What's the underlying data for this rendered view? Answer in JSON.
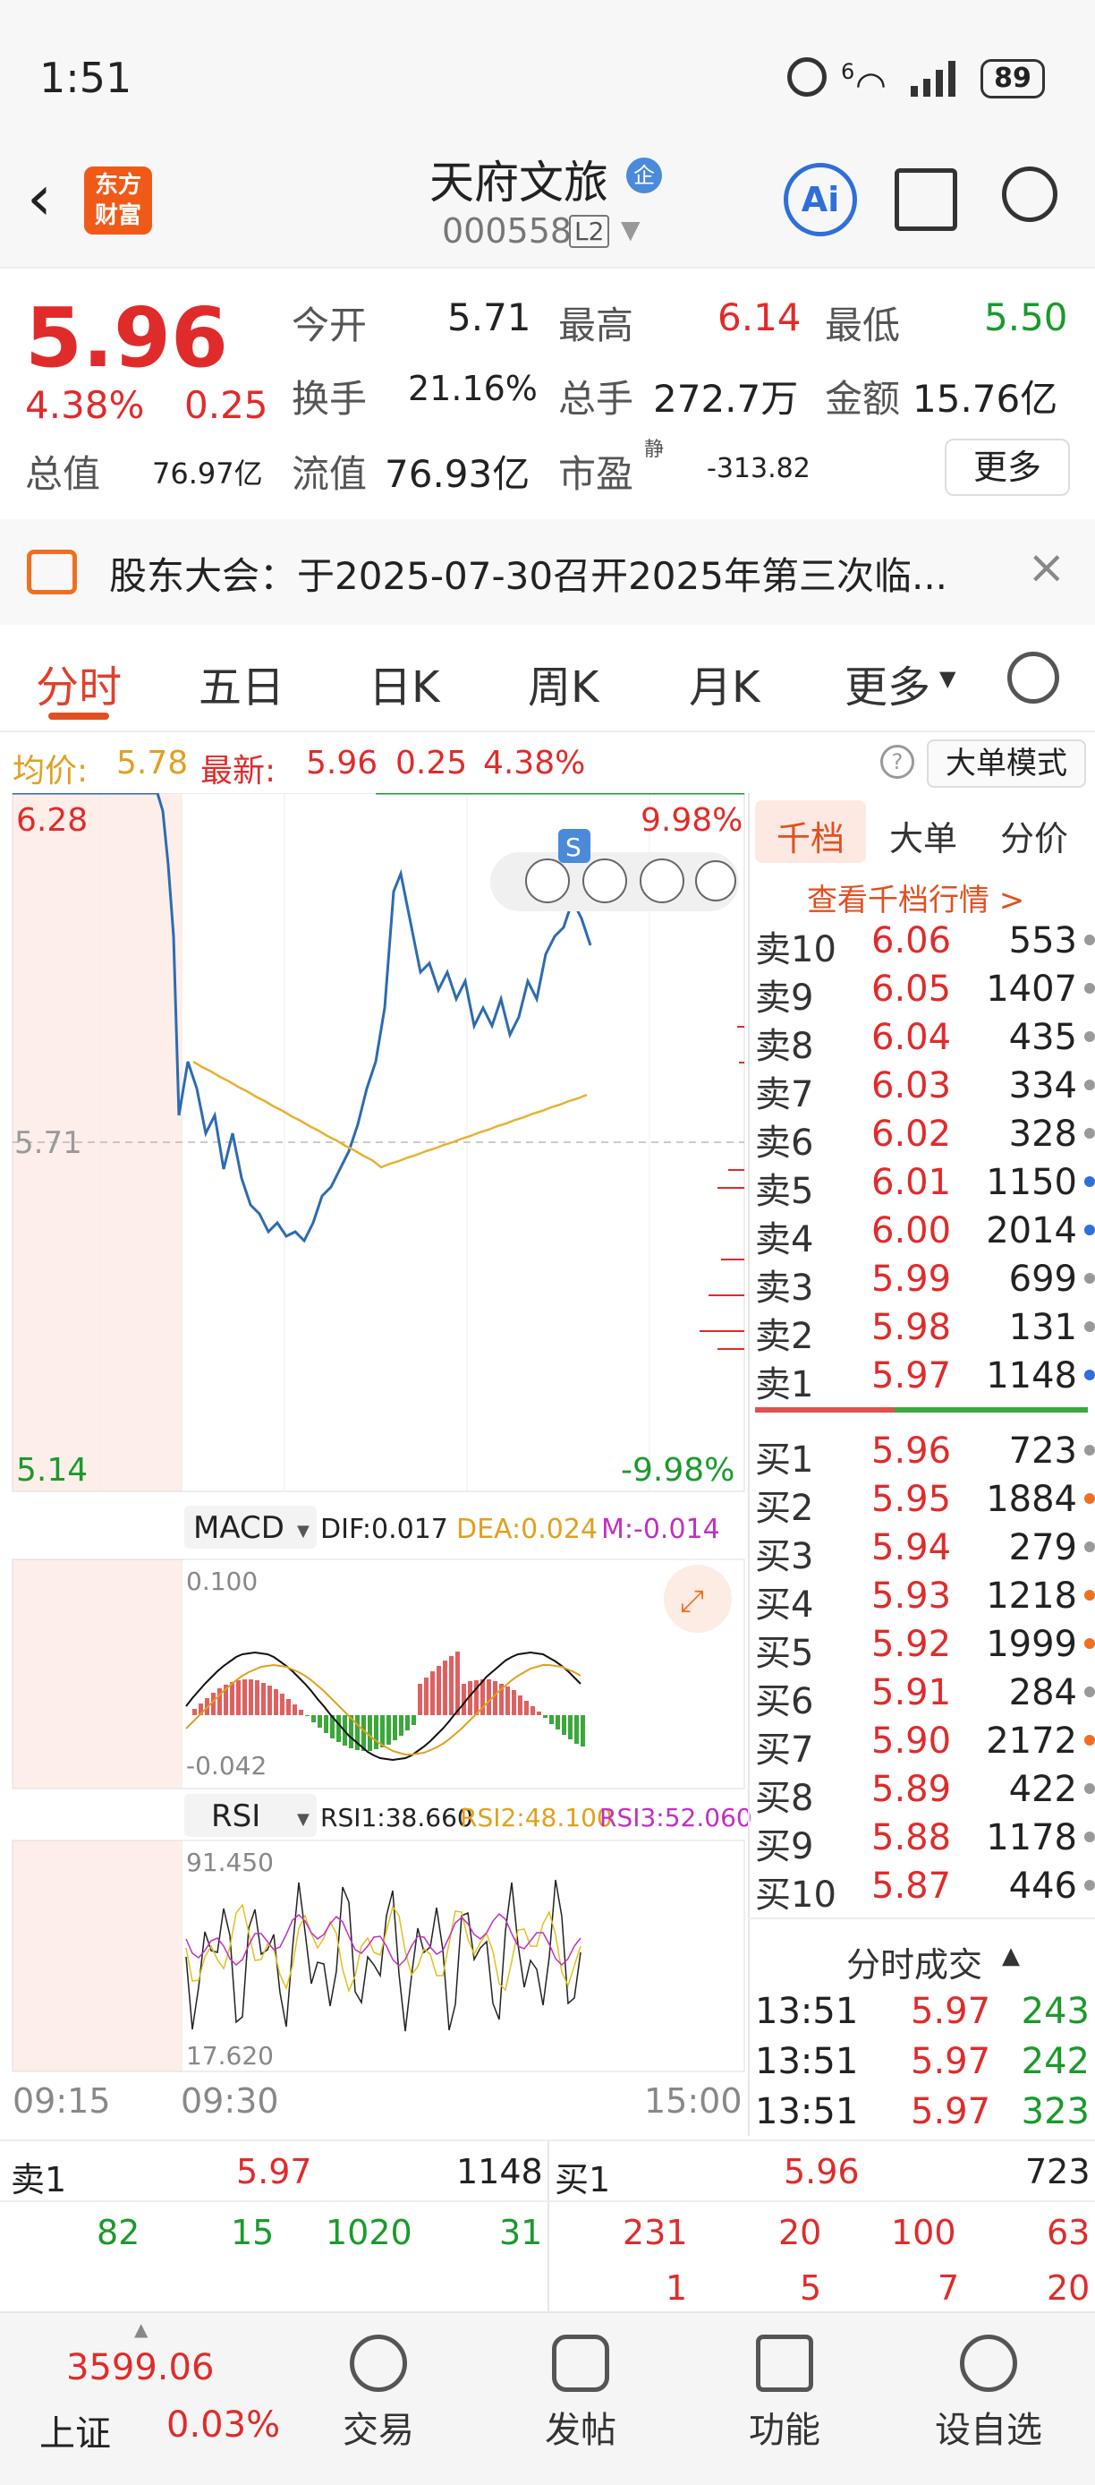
{
  "status_bar": {
    "time": "1:51",
    "battery": "89",
    "network": "6"
  },
  "header": {
    "logo": "东方财富",
    "stock_name": "天府文旅",
    "stock_code": "000558",
    "level": "L2",
    "ai_label": "Ai",
    "badge": "企"
  },
  "quote": {
    "price": "5.96",
    "change_pct": "4.38%",
    "change": "0.25",
    "open_label": "今开",
    "open": "5.71",
    "high_label": "最高",
    "high": "6.14",
    "low_label": "最低",
    "low": "5.50",
    "turnover_label": "换手",
    "turnover": "21.16%",
    "volume_label": "总手",
    "volume": "272.7万",
    "amount_label": "金额",
    "amount": "15.76亿",
    "mktcap_label": "总值",
    "mktcap": "76.97亿",
    "float_label": "流值",
    "float": "76.93亿",
    "pe_label": "市盈",
    "pe_sup": "静",
    "pe": "-313.82",
    "more_label": "更多"
  },
  "notice": {
    "text": "股东大会：于2025-07-30召开2025年第三次临..."
  },
  "tabs": [
    "分时",
    "五日",
    "日K",
    "周K",
    "月K",
    "更多"
  ],
  "chart_info": {
    "avg_label": "均价:",
    "avg": "5.78",
    "last_label": "最新:",
    "last": "5.96",
    "chg": "0.25",
    "pct": "4.38%",
    "mode_label": "大单模式",
    "top_price": "6.28",
    "top_pct": "9.98%",
    "base_price": "5.71",
    "bottom_price": "5.14",
    "bottom_pct": "-9.98%",
    "time_start": "09:15",
    "time_open": "09:30",
    "time_end": "15:00",
    "s_badge": "S"
  },
  "macd": {
    "label": "MACD",
    "dif": "DIF:0.017",
    "dea": "DEA:0.024",
    "m": "M:-0.014",
    "top": "0.100",
    "bottom": "-0.042"
  },
  "rsi": {
    "label": "RSI",
    "rsi1": "RSI1:38.660",
    "rsi2": "RSI2:48.100",
    "rsi3": "RSI3:52.060",
    "top": "91.450",
    "bottom": "17.620"
  },
  "orderbook": {
    "tabs": [
      "千档",
      "大单",
      "分价"
    ],
    "link": "查看千档行情 >",
    "asks": [
      {
        "label": "卖10",
        "price": "6.06",
        "vol": "553",
        "dot": "#999"
      },
      {
        "label": "卖9",
        "price": "6.05",
        "vol": "1407",
        "dot": "#999"
      },
      {
        "label": "卖8",
        "price": "6.04",
        "vol": "435",
        "dot": "#999"
      },
      {
        "label": "卖7",
        "price": "6.03",
        "vol": "334",
        "dot": "#999"
      },
      {
        "label": "卖6",
        "price": "6.02",
        "vol": "328",
        "dot": "#999"
      },
      {
        "label": "卖5",
        "price": "6.01",
        "vol": "1150",
        "dot": "#2e6fd9"
      },
      {
        "label": "卖4",
        "price": "6.00",
        "vol": "2014",
        "dot": "#2e6fd9"
      },
      {
        "label": "卖3",
        "price": "5.99",
        "vol": "699",
        "dot": "#999"
      },
      {
        "label": "卖2",
        "price": "5.98",
        "vol": "131",
        "dot": "#999"
      },
      {
        "label": "卖1",
        "price": "5.97",
        "vol": "1148",
        "dot": "#2e6fd9"
      }
    ],
    "bids": [
      {
        "label": "买1",
        "price": "5.96",
        "vol": "723",
        "dot": "#999"
      },
      {
        "label": "买2",
        "price": "5.95",
        "vol": "1884",
        "dot": "#f07020"
      },
      {
        "label": "买3",
        "price": "5.94",
        "vol": "279",
        "dot": "#999"
      },
      {
        "label": "买4",
        "price": "5.93",
        "vol": "1218",
        "dot": "#f07020"
      },
      {
        "label": "买5",
        "price": "5.92",
        "vol": "1999",
        "dot": "#f07020"
      },
      {
        "label": "买6",
        "price": "5.91",
        "vol": "284",
        "dot": "#999"
      },
      {
        "label": "买7",
        "price": "5.90",
        "vol": "2172",
        "dot": "#f07020"
      },
      {
        "label": "买8",
        "price": "5.89",
        "vol": "422",
        "dot": "#999"
      },
      {
        "label": "买9",
        "price": "5.88",
        "vol": "1178",
        "dot": "#999"
      },
      {
        "label": "买10",
        "price": "5.87",
        "vol": "446",
        "dot": "#999"
      }
    ],
    "ticks_label": "分时成交",
    "ticks": [
      {
        "time": "13:51",
        "price": "5.97",
        "vol": "243"
      },
      {
        "time": "13:51",
        "price": "5.97",
        "vol": "242"
      },
      {
        "time": "13:51",
        "price": "5.97",
        "vol": "323"
      }
    ]
  },
  "depth_strip": {
    "sell_label": "卖1",
    "sell_price": "5.97",
    "sell_vol": "1148",
    "buy_label": "买1",
    "buy_price": "5.96",
    "buy_vol": "723",
    "sell_queue": [
      "82",
      "15",
      "1020",
      "31"
    ],
    "buy_queue": [
      "231",
      "20",
      "100",
      "63"
    ],
    "buy_queue2": [
      "1",
      "5",
      "7",
      "20"
    ]
  },
  "bottom_nav": {
    "index_value": "3599.06",
    "index_name": "上证",
    "index_pct": "0.03%",
    "items": [
      "交易",
      "发帖",
      "功能",
      "设自选"
    ]
  }
}
